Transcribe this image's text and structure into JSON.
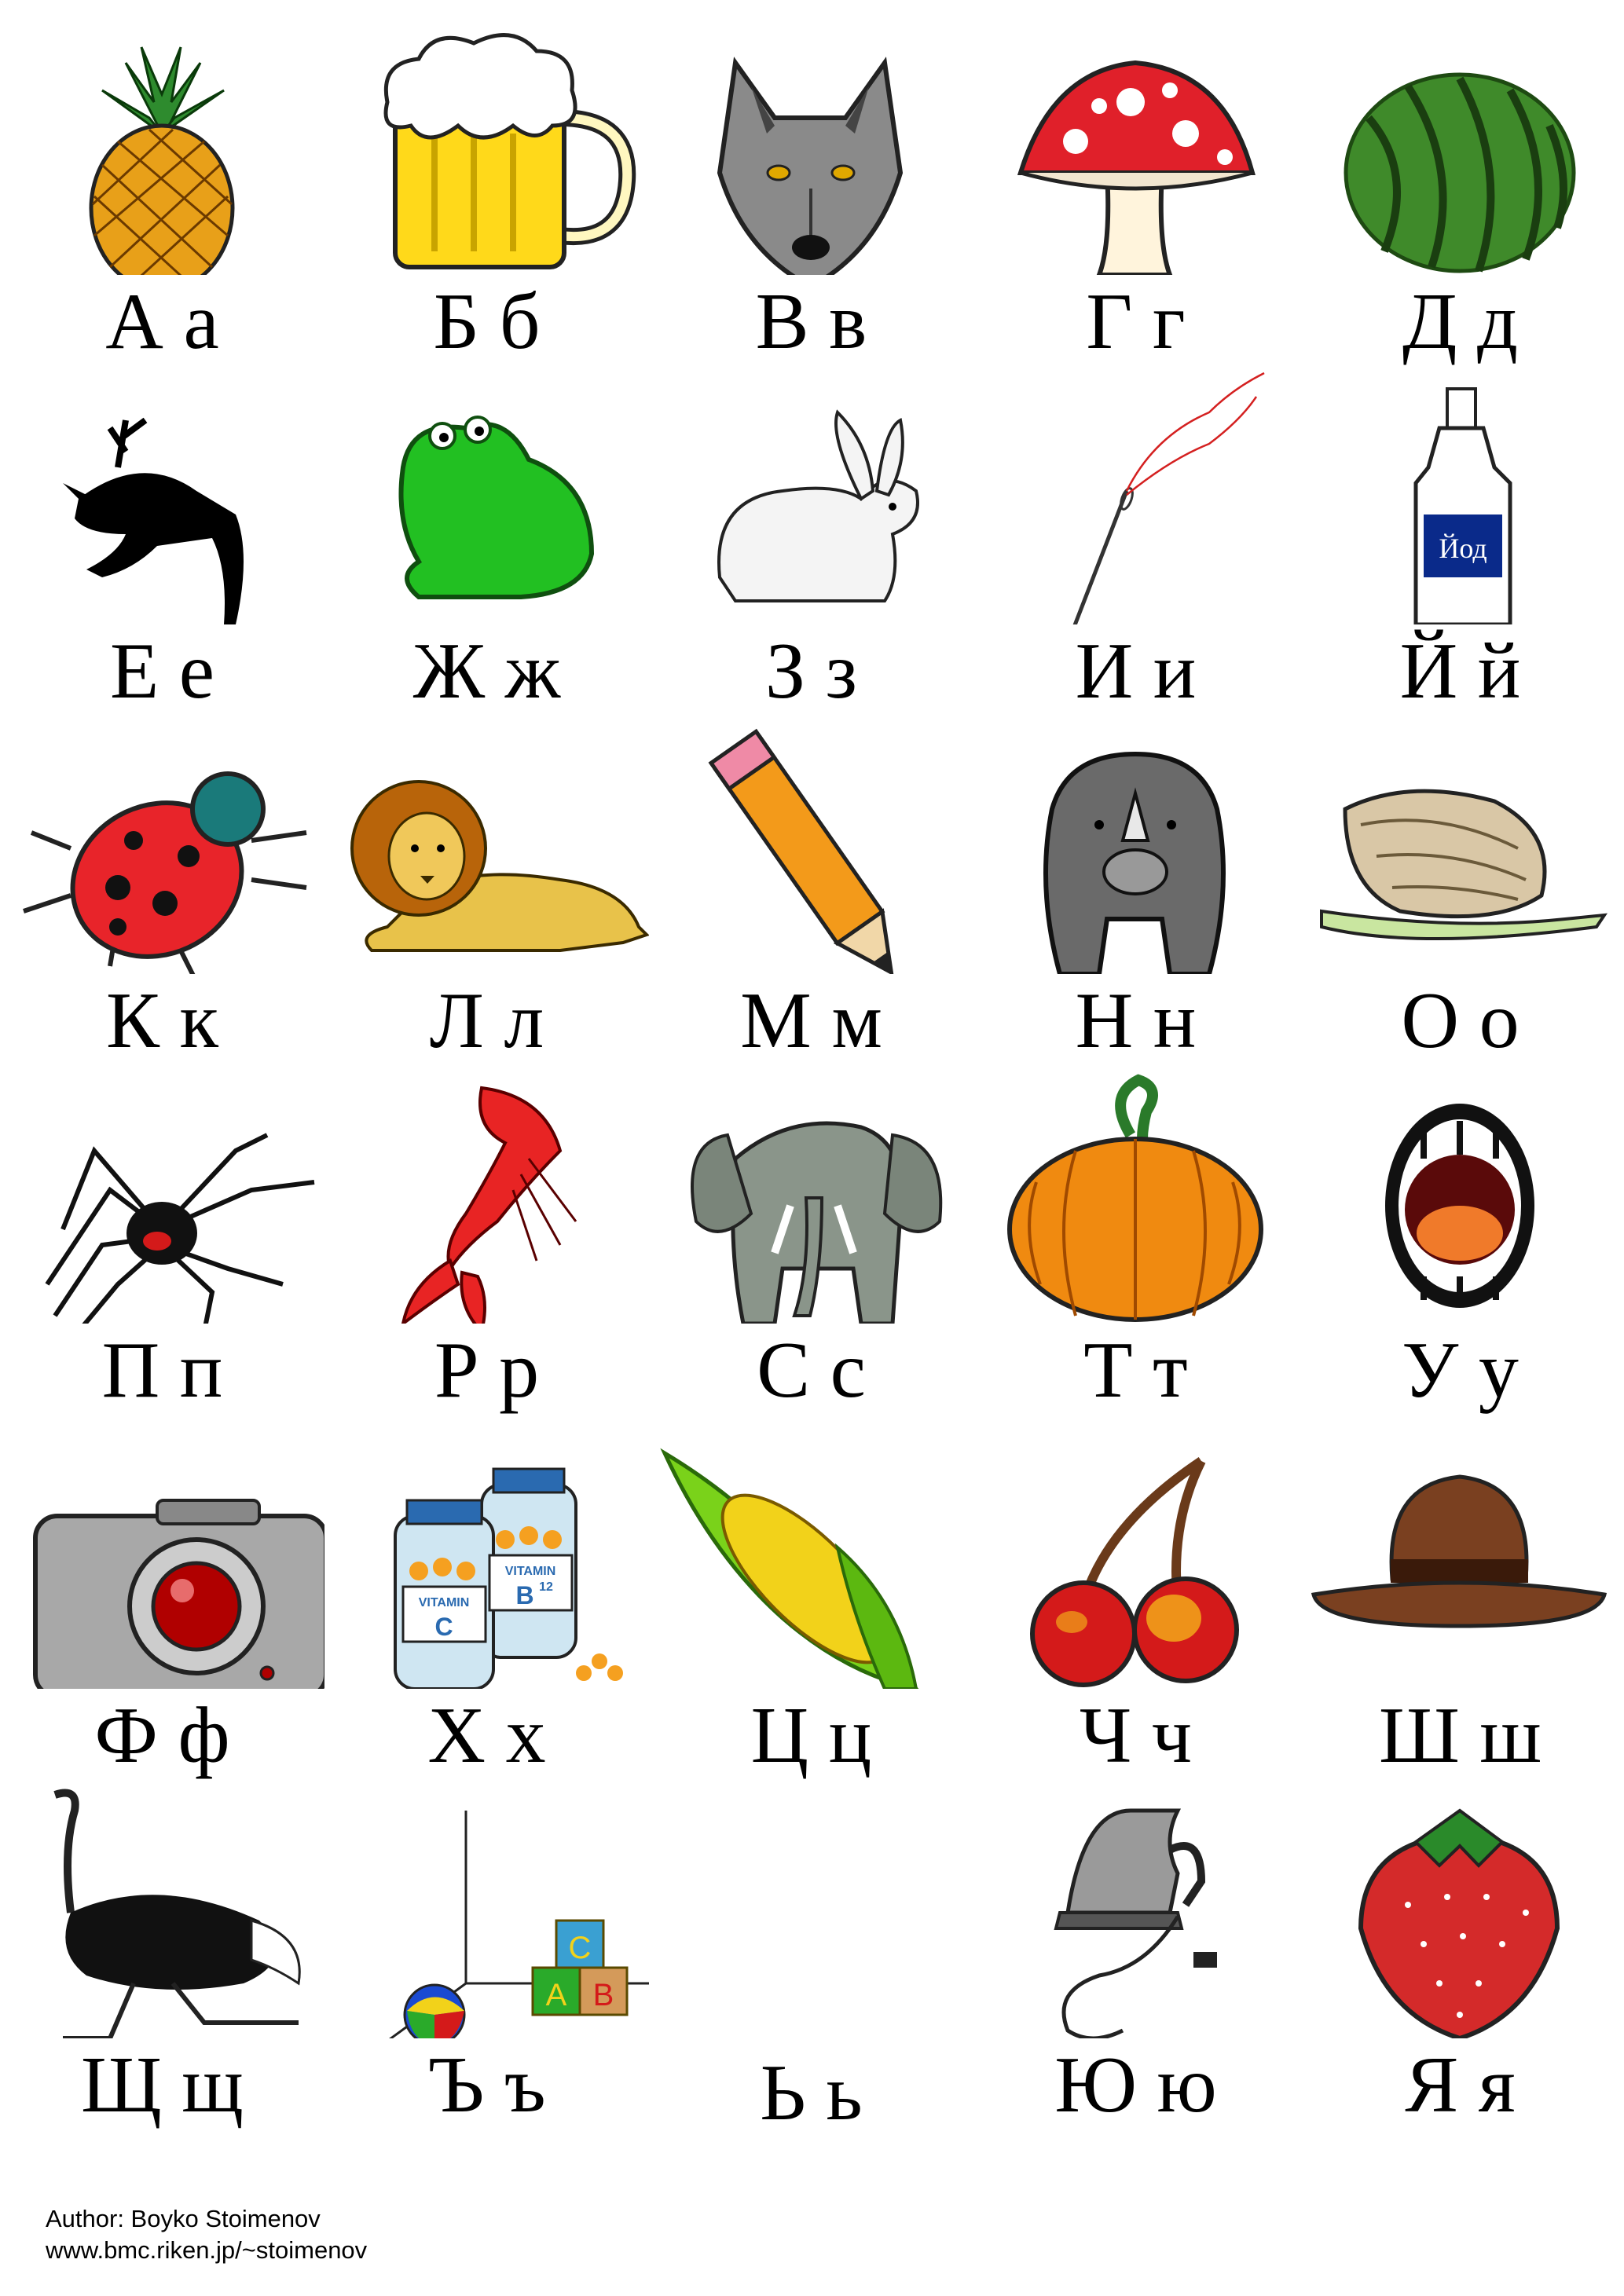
{
  "alphabet": [
    {
      "letter": "А а",
      "picture": "pineapple-icon"
    },
    {
      "letter": "Б б",
      "picture": "beer-mug-icon"
    },
    {
      "letter": "В в",
      "picture": "wolf-icon"
    },
    {
      "letter": "Г г",
      "picture": "mushroom-icon"
    },
    {
      "letter": "Д д",
      "picture": "watermelon-icon"
    },
    {
      "letter": "Е е",
      "picture": "deer-icon"
    },
    {
      "letter": "Ж ж",
      "picture": "frog-icon"
    },
    {
      "letter": "З з",
      "picture": "rabbit-icon"
    },
    {
      "letter": "И и",
      "picture": "needle-icon"
    },
    {
      "letter": "Й й",
      "picture": "iodine-bottle-icon",
      "label": "Йод"
    },
    {
      "letter": "К к",
      "picture": "ladybug-icon"
    },
    {
      "letter": "Л л",
      "picture": "lion-icon"
    },
    {
      "letter": "М м",
      "picture": "pencil-icon"
    },
    {
      "letter": "Н н",
      "picture": "rhino-icon"
    },
    {
      "letter": "О о",
      "picture": "snail-icon"
    },
    {
      "letter": "П п",
      "picture": "spider-icon"
    },
    {
      "letter": "Р р",
      "picture": "crayfish-icon"
    },
    {
      "letter": "С с",
      "picture": "elephant-icon"
    },
    {
      "letter": "Т т",
      "picture": "pumpkin-icon"
    },
    {
      "letter": "У у",
      "picture": "mouth-icon"
    },
    {
      "letter": "Ф ф",
      "picture": "camera-icon"
    },
    {
      "letter": "Х х",
      "picture": "vitamins-icon",
      "label_c": "VITAMIN",
      "label_c2": "C",
      "label_b": "VITAMIN",
      "label_b2": "B",
      "label_b3": "12"
    },
    {
      "letter": "Ц ц",
      "picture": "corn-icon"
    },
    {
      "letter": "Ч ч",
      "picture": "cherries-icon"
    },
    {
      "letter": "Ш ш",
      "picture": "hat-icon"
    },
    {
      "letter": "Щ щ",
      "picture": "ostrich-icon"
    },
    {
      "letter": "Ъ ъ",
      "picture": "toy-blocks-icon",
      "block1": "C",
      "block2": "A",
      "block3": "B"
    },
    {
      "letter": "Ь ь",
      "picture": "none"
    },
    {
      "letter": "Ю ю",
      "picture": "iron-icon"
    },
    {
      "letter": "Я я",
      "picture": "strawberry-icon"
    }
  ],
  "credits": {
    "author": "Author: Boyko Stoimenov",
    "url": "www.bmc.riken.jp/~stoimenov"
  }
}
